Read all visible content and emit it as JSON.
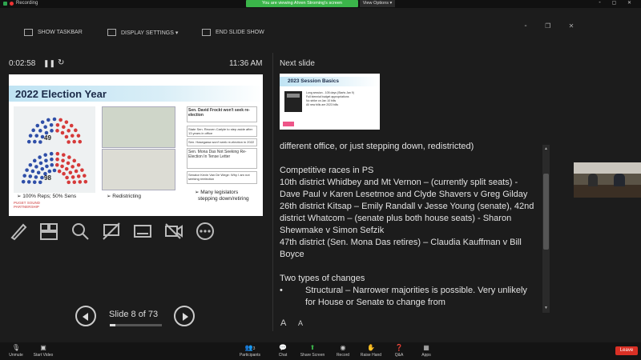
{
  "topbar": {
    "recording": "Recording",
    "viewing_banner": "You are viewing Ahren Stroming's screen",
    "view_options": "View Options ▾"
  },
  "presenter_toolbar": {
    "show_taskbar": "SHOW TASKBAR",
    "display_settings": "DISPLAY SETTINGS ▾",
    "end_slide_show": "END SLIDE SHOW"
  },
  "timer": {
    "elapsed": "0:02:58",
    "clock": "11:36 AM"
  },
  "current_slide": {
    "title": "2022 Election Year",
    "seats_top": "49",
    "seats_bottom": "98",
    "bullet_reps": "➢ 100% Reps; 50% Sens",
    "bullet_redistricting": "➢ Redistricting",
    "bullet_legislators_1": "➢ Many legislators",
    "bullet_legislators_2": "stepping down/retiring",
    "clip1": "Sen. David Frockt won't seek re-election",
    "clip2": "State Sen. Reuven Carlyle to step aside after 13 years in office",
    "clip3": "Sen. Hasegawa won't seek re-election in 2022",
    "clip4": "Sen. Mona Das Not Seeking Re-Election In Tense Letter",
    "clip5": "Senator Kevin Van De Wege: Why I am not seeking reelection",
    "logo_1": "PUGET SOUND",
    "logo_2": "PARTNERSHIP"
  },
  "navigation": {
    "slide_label": "Slide 8 of 73",
    "progress": 0.11
  },
  "next_slide": {
    "label": "Next slide",
    "title": "2023 Session Basics",
    "line1": "Long session - 105 days (Starts Jan 9)",
    "line2": "Full biennial budget appropriations",
    "line3": "No strike on Jan 10 bills",
    "line4": "All new bills are 2023 bills"
  },
  "notes": {
    "line0": "different office, or just stepping down, redistricted)",
    "line1": "Competitive races in PS",
    "line2": "10th district Whidbey and Mt Vernon – (currently split seats) - Dave Paul v Karen Lesetmoe and Clyde Shavers v Greg Gilday",
    "line3": "26th district Kitsap – Emily Randall v Jesse Young (senate), 42nd district Whatcom – (senate plus both house seats) - Sharon Shewmake v Simon Sefzik",
    "line4": "47th district (Sen. Mona Das retires) – Claudia Kauffman v Bill Boyce",
    "line5": "Two types of changes",
    "bullet": "•",
    "line6": "Structural – Narrower majorities is possible. Very unlikely for House or Senate to change from"
  },
  "font_controls": {
    "increase": "A",
    "decrease": "A"
  },
  "bottombar": {
    "unmute": "Unmute",
    "start_video": "Start Video",
    "participants": "Participants",
    "participants_count": "3",
    "chat": "Chat",
    "share_screen": "Share Screen",
    "record": "Record",
    "raise_hand": "Raise Hand",
    "qa": "Q&A",
    "apps": "Apps",
    "leave": "Leave"
  },
  "colors": {
    "accent_green": "#3bb54a",
    "leave_red": "#d93025",
    "rep_red": "#d63a3a",
    "dem_blue": "#2f4fa8"
  }
}
